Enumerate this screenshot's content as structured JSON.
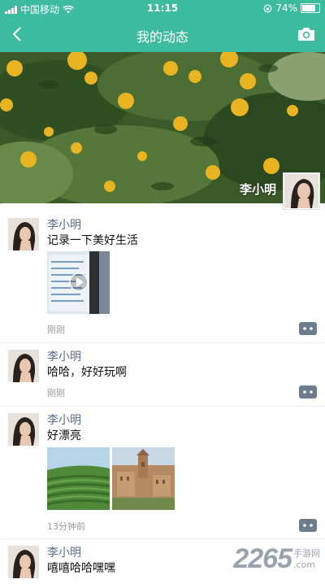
{
  "status_bar": {
    "carrier": "中国移动",
    "time": "11:15",
    "battery": "74%",
    "battery_level": 0.74
  },
  "nav": {
    "title": "我的动态"
  },
  "cover": {
    "name": "李小明"
  },
  "posts": [
    {
      "author": "李小明",
      "content": "记录一下美好生活",
      "time": "刚刚"
    },
    {
      "author": "李小明",
      "content": "哈哈，好好玩啊",
      "time": "刚刚"
    },
    {
      "author": "李小明",
      "content": "好漂亮",
      "time": "13分钟前"
    },
    {
      "author": "李小明",
      "content": "嘻嘻哈哈嘿嘿"
    }
  ],
  "colors": {
    "theme": "#3dbb9e",
    "author": "#5b6b93",
    "icon_gray": "#6e7d8c"
  },
  "watermark": {
    "number": "2265",
    "suffix": "手游网",
    "dot_com": ".com"
  }
}
